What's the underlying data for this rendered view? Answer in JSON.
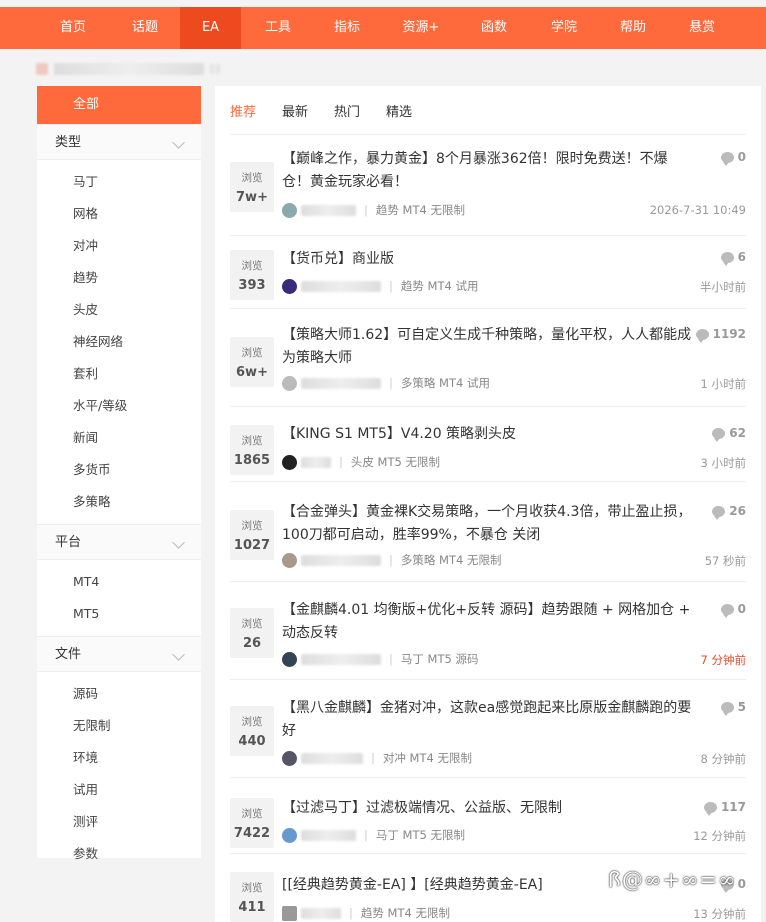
{
  "topnav": {
    "items": [
      {
        "label": "首页"
      },
      {
        "label": "话题"
      },
      {
        "label": "EA"
      },
      {
        "label": "工具"
      },
      {
        "label": "指标"
      },
      {
        "label": "资源+"
      },
      {
        "label": "函数"
      },
      {
        "label": "学院"
      },
      {
        "label": "帮助"
      },
      {
        "label": "悬赏"
      }
    ],
    "active": "EA"
  },
  "sidebar": {
    "all_label": "全部",
    "groups": [
      {
        "title": "类型",
        "items": [
          "马丁",
          "网格",
          "对冲",
          "趋势",
          "头皮",
          "神经网络",
          "套利",
          "水平/等级",
          "新闻",
          "多货币",
          "多策略"
        ]
      },
      {
        "title": "平台",
        "items": [
          "MT4",
          "MT5"
        ]
      },
      {
        "title": "文件",
        "items": [
          "源码",
          "无限制",
          "环境",
          "试用",
          "测评",
          "参数"
        ]
      }
    ]
  },
  "tabs": [
    "推荐",
    "最新",
    "热门",
    "精选"
  ],
  "views_label": "浏览",
  "posts": [
    {
      "views": "7w+",
      "title": "【巅峰之作，暴力黄金】8个月暴涨362倍！限时免费送！不爆仓！黄金玩家必看！",
      "comments": "0",
      "tags": "趋势 MT4 无限制",
      "time": "2026-7-31 10:49",
      "avatar_color": "#8aa"
    },
    {
      "views": "393",
      "title": "【货币兑】商业版",
      "comments": "6",
      "tags": "趋势 MT4 试用",
      "time": "半小时前",
      "avatar_color": "#3a2a7a"
    },
    {
      "views": "6w+",
      "title": "【策略大师1.62】可自定义生成千种策略，量化平权，人人都能成为策略大师",
      "comments": "1192",
      "tags": "多策略 MT4 试用",
      "time": "1 小时前",
      "avatar_color": "#bbb"
    },
    {
      "views": "1865",
      "title": "【KING S1 MT5】V4.20 策略剥头皮",
      "comments": "62",
      "tags": "头皮 MT5 无限制",
      "time": "3 小时前",
      "avatar_color": "#222"
    },
    {
      "views": "1027",
      "title": "【合金弹头】黄金裸K交易策略，一个月收获4.3倍，带止盈止损，100刀都可启动，胜率99%，不暴仓 关闭",
      "comments": "26",
      "tags": "多策略 MT4 无限制",
      "time": "57 秒前",
      "avatar_color": "#a98"
    },
    {
      "views": "26",
      "title": "【金麒麟4.01 均衡版+优化+反转 源码】趋势跟随 + 网格加仓 + 动态反转",
      "comments": "0",
      "tags": "马丁 MT5 源码",
      "time": "7 分钟前",
      "time_red": true,
      "avatar_color": "#345"
    },
    {
      "views": "440",
      "title": "【黑八金麒麟】金猪对冲，这款ea感觉跑起来比原版金麒麟跑的要好",
      "comments": "5",
      "tags": "对冲 MT4 无限制",
      "time": "8 分钟前",
      "avatar_color": "#556"
    },
    {
      "views": "7422",
      "title": "【过滤马丁】过滤极端情况、公益版、无限制",
      "comments": "117",
      "tags": "马丁 MT5 无限制",
      "time": "12 分钟前",
      "avatar_color": "#69c"
    },
    {
      "views": "411",
      "title": "[[经典趋势黄金-EA] 】[经典趋势黄金-EA]",
      "comments": "0",
      "tags": "趋势 MT4 无限制",
      "time": "13 分钟前",
      "avatar_color": "#999"
    }
  ],
  "watermark": "ꟗ@∞+∞=∞"
}
